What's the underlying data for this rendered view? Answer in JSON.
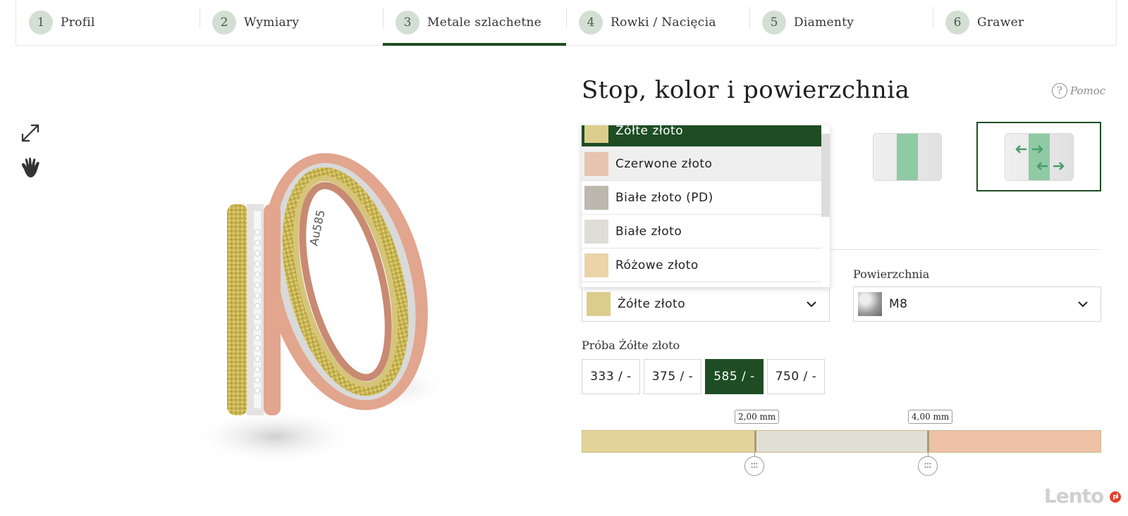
{
  "steps": [
    {
      "num": "1",
      "label": "Profil"
    },
    {
      "num": "2",
      "label": "Wymiary"
    },
    {
      "num": "3",
      "label": "Metale szlachetne"
    },
    {
      "num": "4",
      "label": "Rowki / Nacięcia"
    },
    {
      "num": "5",
      "label": "Diamenty"
    },
    {
      "num": "6",
      "label": "Grawer"
    }
  ],
  "active_step": "3",
  "heading": "Stop, kolor i powierzchnia",
  "help": {
    "icon": "?",
    "label": "Pomoc"
  },
  "ring_engraving": "Au585",
  "metal_dropdown": {
    "options": [
      {
        "label": "Żółte złoto",
        "color": "#dccd8c",
        "state": "selected"
      },
      {
        "label": "Czerwone złoto",
        "color": "#e7c4b0",
        "state": "hover"
      },
      {
        "label": "Białe złoto (PD)",
        "color": "#bcb8ae"
      },
      {
        "label": "Białe złoto",
        "color": "#dedcd4"
      },
      {
        "label": "Różowe złoto",
        "color": "#ecd3a8"
      }
    ]
  },
  "metal_select": {
    "value": "Żółte złoto",
    "color": "#dccd8c"
  },
  "surface": {
    "label": "Powierzchnia",
    "value": "M8"
  },
  "purity": {
    "label": "Próba Żółte złoto",
    "options": [
      "333 / -",
      "375 / -",
      "585 / -",
      "750 / -"
    ],
    "active": "585 / -"
  },
  "width_bar": {
    "markers": [
      "2,00 mm",
      "4,00 mm"
    ],
    "segments": [
      {
        "metal": "Żółte złoto",
        "color": "#e3d49a"
      },
      {
        "metal": "Białe złoto",
        "color": "#e2e0d6"
      },
      {
        "metal": "Czerwone złoto",
        "color": "#eec2a6"
      }
    ]
  },
  "accent_color": "#1e4d24",
  "watermark": "Lento"
}
